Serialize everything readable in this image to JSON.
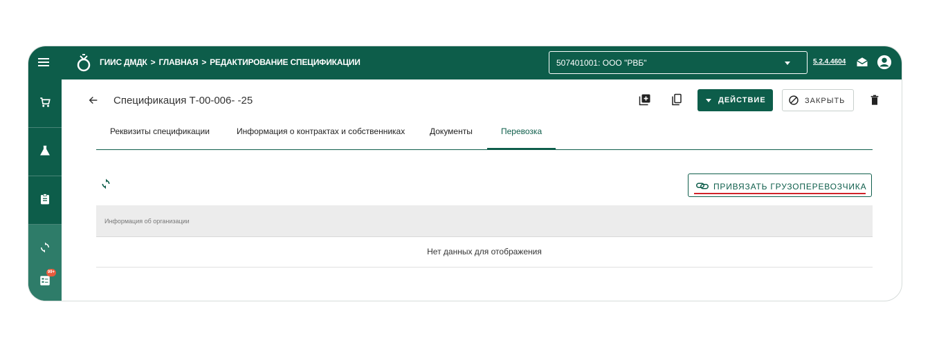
{
  "topbar": {
    "breadcrumb": [
      "ГИИС ДМДК",
      "ГЛАВНАЯ",
      "РЕДАКТИРОВАНИЕ СПЕЦИФИКАЦИИ"
    ],
    "breadcrumb_separator": ">",
    "org_select_value": "507401001: ООО \"РВБ\"",
    "version": "5.2.4.4604",
    "color_primary": "#0d5d4a"
  },
  "sidebar": {
    "items": [
      {
        "icon": "cart-icon"
      },
      {
        "icon": "flask-icon"
      },
      {
        "icon": "clipboard-icon"
      },
      {
        "icon": "sync-icon",
        "active": true
      },
      {
        "icon": "notifications-list-icon",
        "badge": "99+"
      }
    ]
  },
  "page": {
    "title": "Спецификация Т-00-006-       -25",
    "action_label": "ДЕЙСТВИЕ",
    "close_label": "ЗАКРЫТЬ"
  },
  "tabs": [
    {
      "label": "Реквизиты спецификации"
    },
    {
      "label": "Информация о контрактах и собственниках"
    },
    {
      "label": "Документы"
    },
    {
      "label": "Перевозка",
      "active": true
    }
  ],
  "transport": {
    "bind_carrier_label": "ПРИВЯЗАТЬ ГРУЗОПЕРЕВОЗЧИКА",
    "table_column": "Информация об организации",
    "empty_text": "Нет данных для отображения",
    "highlight_color": "#d2232a"
  }
}
